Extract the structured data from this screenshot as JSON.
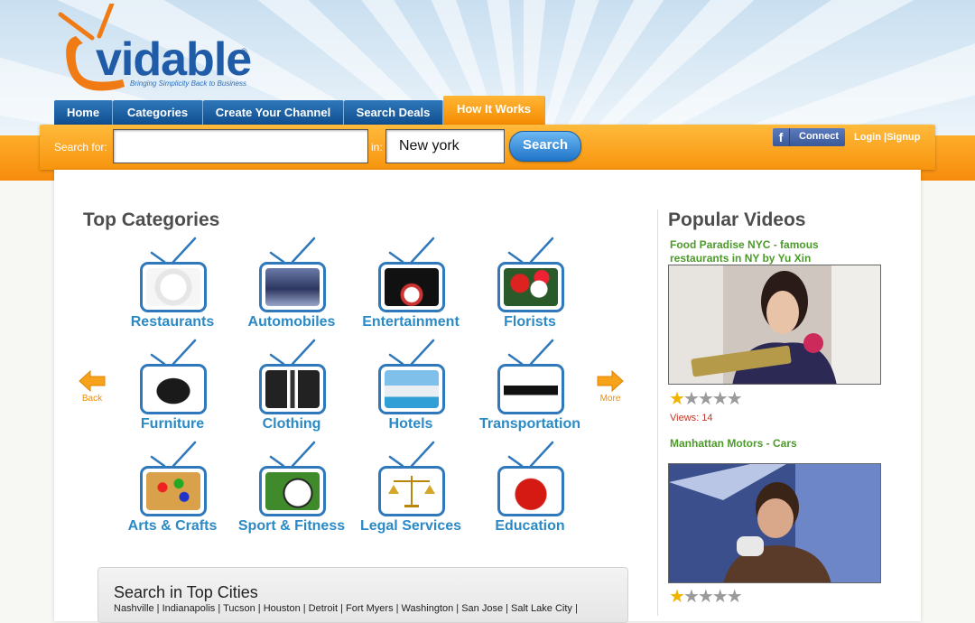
{
  "brand": {
    "name": "vidable",
    "reg": "®",
    "tagline": "Bringing Simplicity Back to Business",
    "colors": {
      "blue": "#1f5ba6",
      "orange": "#f7940d",
      "green": "#4c9a2a",
      "link": "#2b8ac6"
    }
  },
  "nav": {
    "tabs": [
      "Home",
      "Categories",
      "Create Your Channel",
      "Search Deals",
      "How It Works"
    ],
    "active": "How It Works"
  },
  "search": {
    "for_label": "Search for:",
    "query_value": "",
    "in_label": "in:",
    "location_value": "New york",
    "button_label": "Search"
  },
  "auth": {
    "connect_label": "Connect",
    "connect_icon": "facebook-icon",
    "login_label": "Login",
    "separator": "|",
    "signup_label": "Signup"
  },
  "categories": {
    "title": "Top Categories",
    "back_label": "Back",
    "more_label": "More",
    "items": [
      {
        "name": "Restaurants",
        "icon": "salad-plate-icon"
      },
      {
        "name": "Automobiles",
        "icon": "car-icon"
      },
      {
        "name": "Entertainment",
        "icon": "bowling-icon"
      },
      {
        "name": "Florists",
        "icon": "flowers-icon"
      },
      {
        "name": "Furniture",
        "icon": "armchair-icon"
      },
      {
        "name": "Clothing",
        "icon": "suit-icon"
      },
      {
        "name": "Hotels",
        "icon": "hotel-pool-icon"
      },
      {
        "name": "Transportation",
        "icon": "limousine-icon"
      },
      {
        "name": "Arts & Crafts",
        "icon": "palette-icon"
      },
      {
        "name": "Sport & Fitness",
        "icon": "soccer-ball-icon"
      },
      {
        "name": "Legal Services",
        "icon": "scales-icon"
      },
      {
        "name": "Education",
        "icon": "apple-icon"
      }
    ]
  },
  "cities": {
    "title": "Search in Top Cities",
    "list": "Nashville | Indianapolis | Tucson | Houston | Detroit | Fort Myers | Washington | San Jose | Salt Lake City |"
  },
  "videos": {
    "title": "Popular Videos",
    "items": [
      {
        "title_line1": "Food Paradise NYC - famous",
        "title_line2": "restaurants in NY by Yu Xin",
        "rating": 1,
        "max_rating": 5,
        "views_label": "Views: 14"
      },
      {
        "title_line1": "Manhattan Motors - Cars",
        "title_line2": "",
        "rating": 1,
        "max_rating": 5,
        "views_label": ""
      }
    ]
  }
}
